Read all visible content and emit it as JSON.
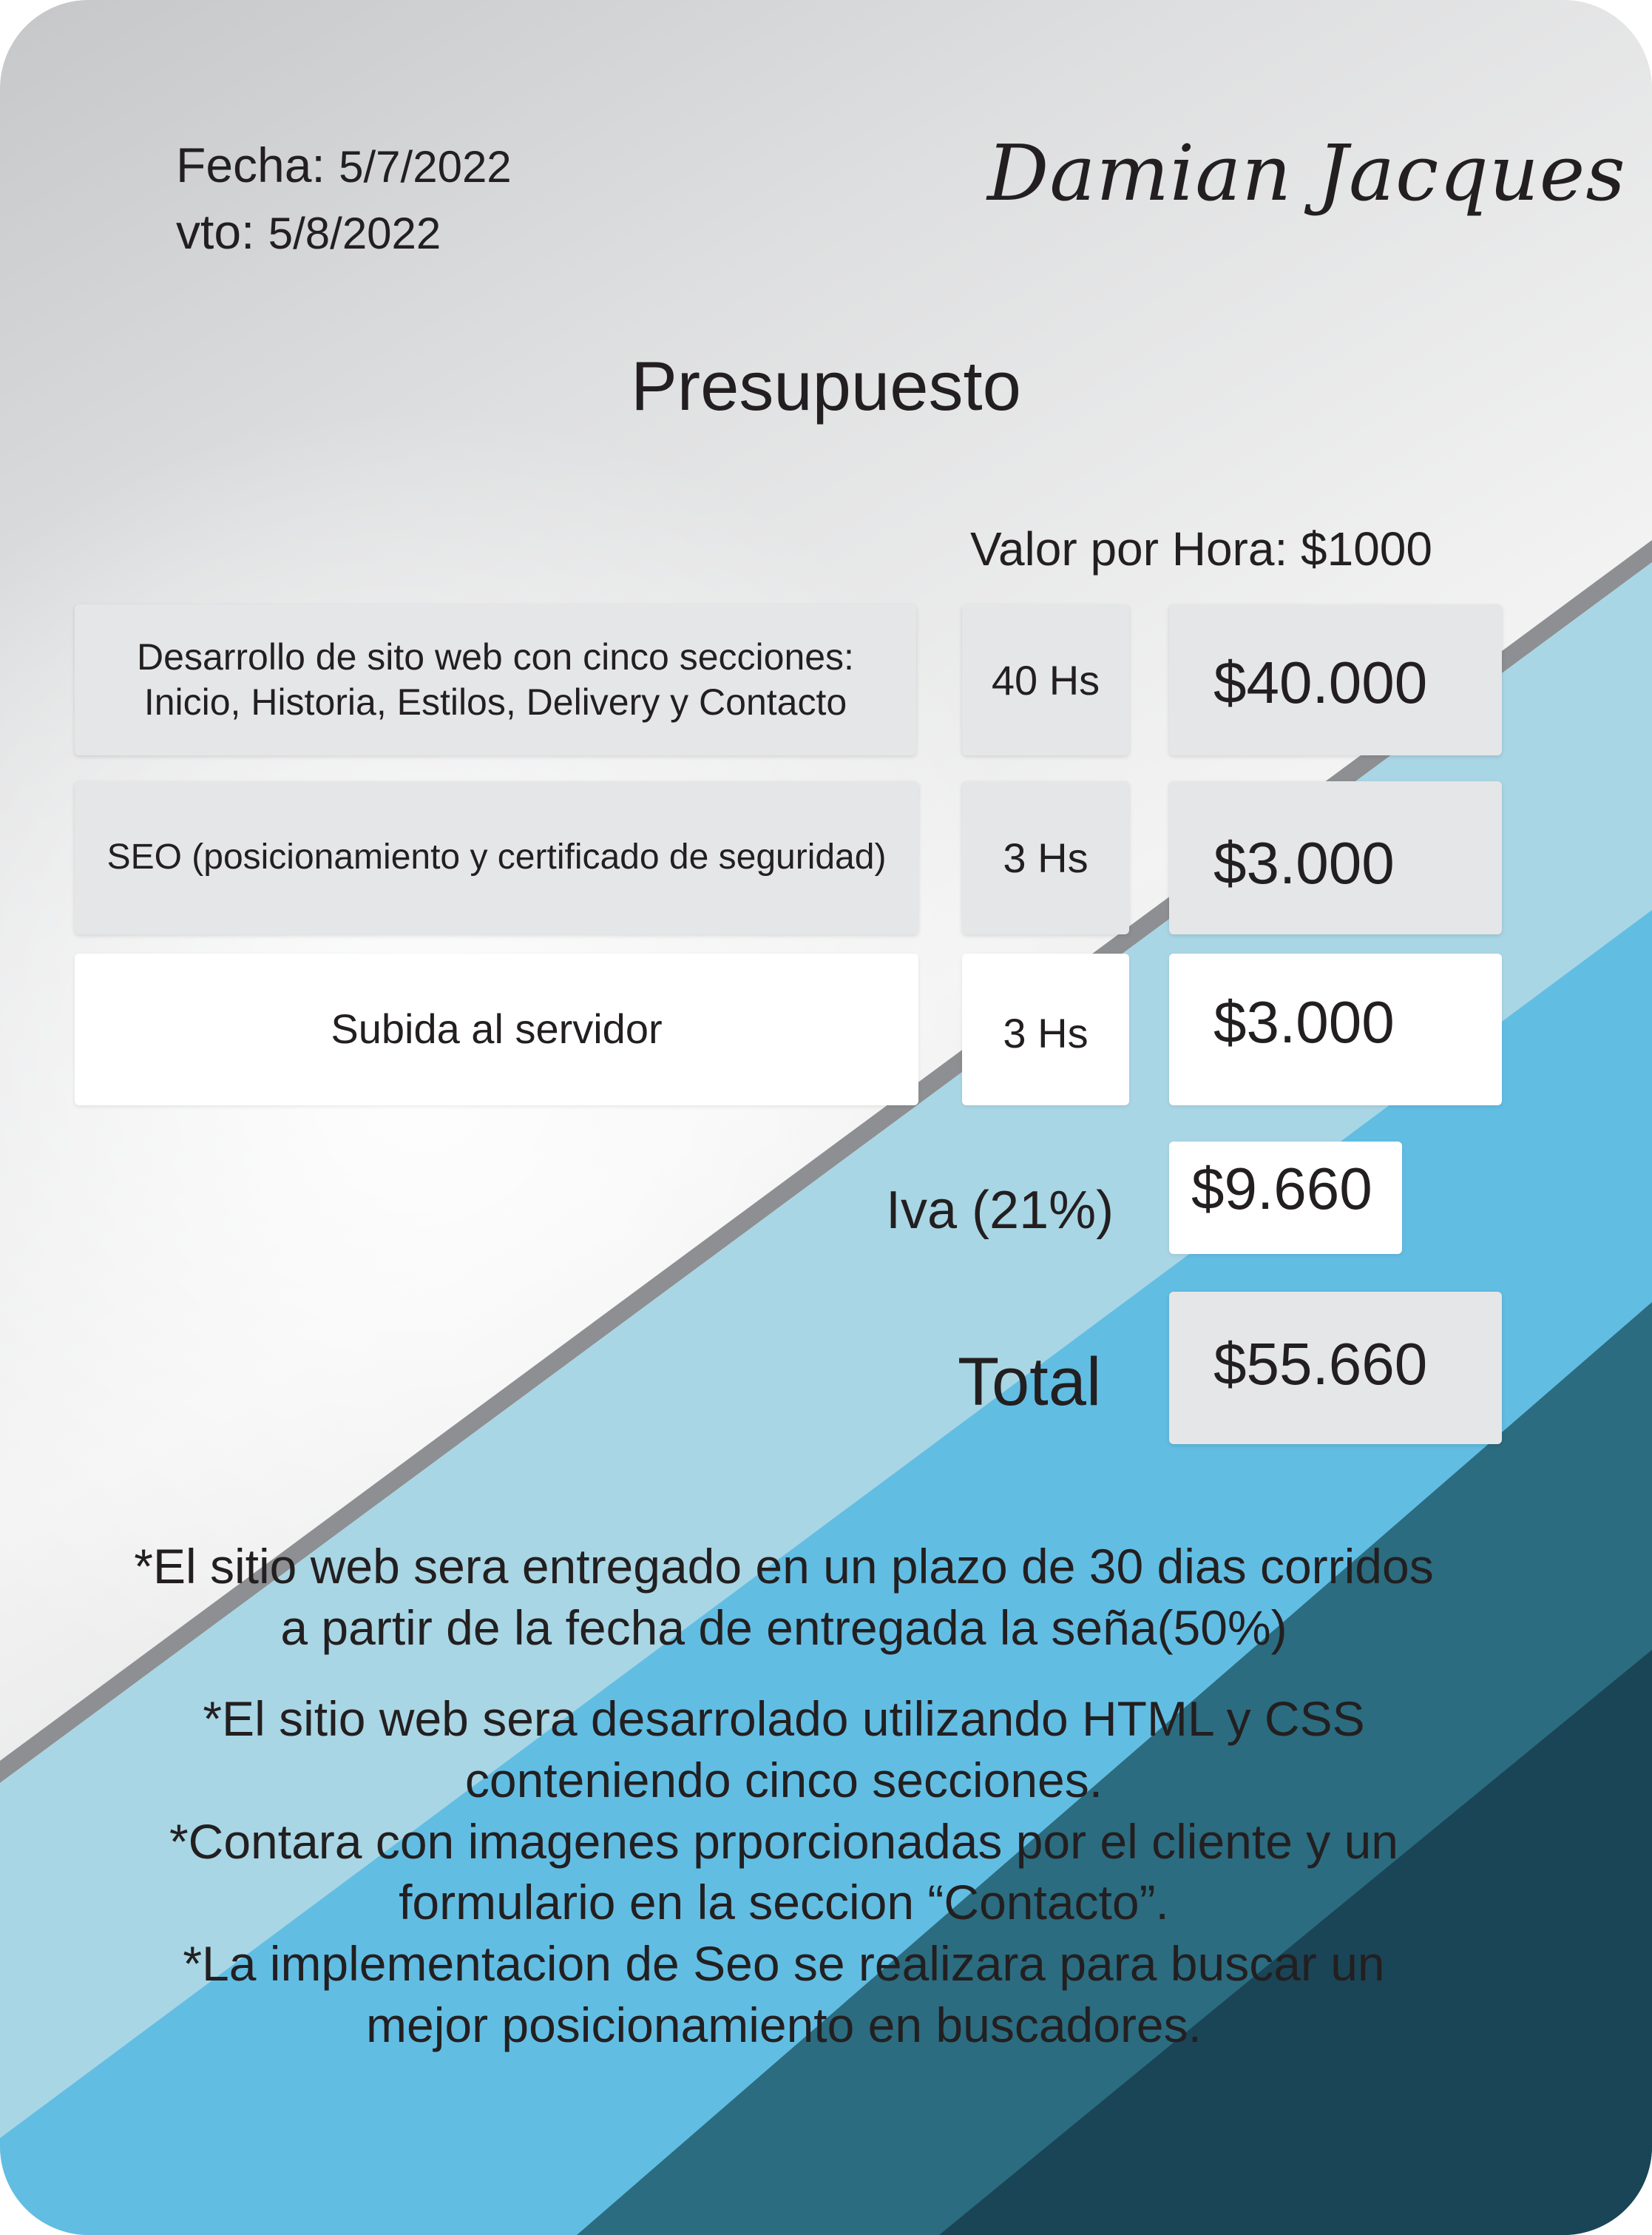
{
  "header": {
    "fecha_label": "Fecha:",
    "fecha_value": "5/7/2022",
    "vto_label": "vto:",
    "vto_value": "5/8/2022",
    "signature": "Damian Jacques"
  },
  "title": "Presupuesto",
  "rate": "Valor por Hora: $1000",
  "items": [
    {
      "description": "Desarrollo de sito web con cinco secciones:\nInicio, Historia, Estilos, Delivery y Contacto",
      "hours": "40 Hs",
      "amount": "$40.000"
    },
    {
      "description": "SEO (posicionamiento y certificado de seguridad)",
      "hours": "3 Hs",
      "amount": "$3.000"
    },
    {
      "description": "Subida al servidor",
      "hours": "3 Hs",
      "amount": "$3.000"
    }
  ],
  "iva": {
    "label": "Iva (21%)",
    "amount": "$9.660"
  },
  "total": {
    "label": "Total",
    "amount": "$55.660"
  },
  "notes": {
    "note1": "*El sitio web sera entregado en un plazo de 30 dias corridos\na partir de la fecha de entregada la seña(50%)",
    "note2": "*El sitio web sera desarrolado utilizando HTML y CSS\nconteniendo cinco secciones.\n*Contara con imagenes prporcionadas por el cliente y un\nformulario en la seccion “Contacto”.\n*La implementacion de Seo se realizara para buscar un\nmejor posicionamiento en buscadores."
  },
  "colors": {
    "light_blue": "#a9d6e5",
    "sky_blue": "#62bde3",
    "teal": "#2b6c80",
    "dark_teal": "#1a4556",
    "cell_gray": "#e5e6e7"
  }
}
